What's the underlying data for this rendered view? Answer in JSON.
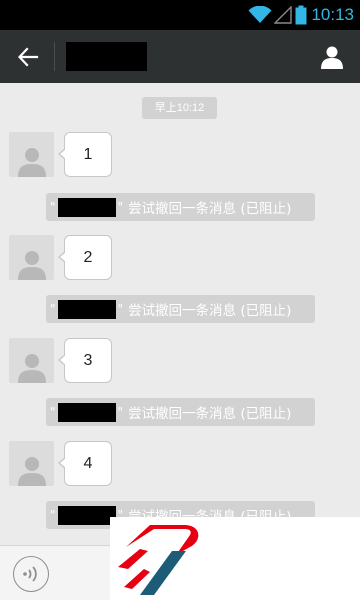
{
  "status_bar": {
    "time": "10:13",
    "accent_color": "#33b5e5",
    "icons": [
      "wifi-icon",
      "signal-icon",
      "battery-icon"
    ]
  },
  "action_bar": {
    "back_icon": "back-arrow-icon",
    "profile_icon": "person-icon",
    "title": ""
  },
  "chat": {
    "timestamp": "早上10:12",
    "messages": [
      {
        "text": "1",
        "notice": {
          "open_quote": "\"",
          "close_quote": "\"",
          "text": "尝试撤回一条消息 (已阻止)"
        }
      },
      {
        "text": "2",
        "notice": {
          "open_quote": "\"",
          "close_quote": "\"",
          "text": "尝试撤回一条消息 (已阻止)"
        }
      },
      {
        "text": "3",
        "notice": {
          "open_quote": "\"",
          "close_quote": "\"",
          "text": "尝试撤回一条消息 (已阻止)"
        }
      },
      {
        "text": "4",
        "notice": {
          "open_quote": "\"",
          "close_quote": "\"",
          "text": "尝试撤回一条消息 (已阻止)"
        }
      }
    ]
  },
  "bottom_bar": {
    "voice_icon": "voice-icon"
  },
  "overlay": {
    "logo": "brand-logo"
  },
  "colors": {
    "chat_bg": "#ebebeb",
    "action_bar_bg": "#2e3132",
    "logo_red": "#e60012",
    "logo_blue": "#1d5c76"
  }
}
